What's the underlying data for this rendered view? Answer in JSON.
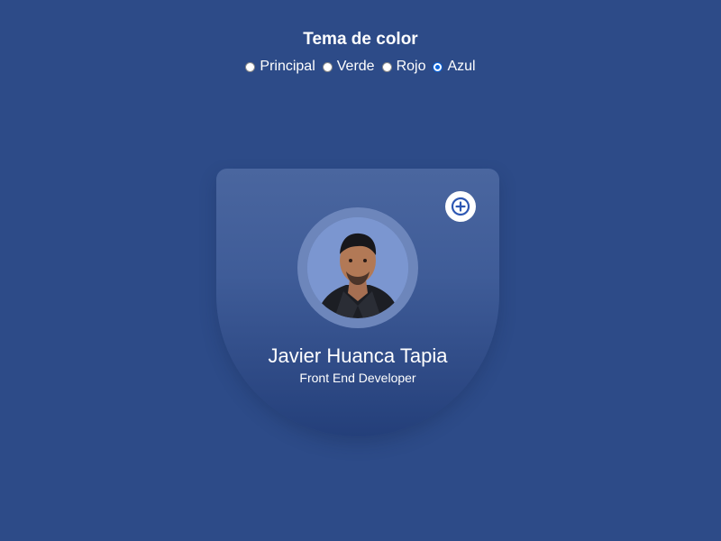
{
  "theme_selector": {
    "title": "Tema de color",
    "options": [
      {
        "label": "Principal",
        "checked": false
      },
      {
        "label": "Verde",
        "checked": false
      },
      {
        "label": "Rojo",
        "checked": false
      },
      {
        "label": "Azul",
        "checked": true
      }
    ]
  },
  "profile_card": {
    "name": "Javier Huanca Tapia",
    "role": "Front End Developer",
    "add_icon": "plus-circle-icon",
    "photo_icon": "profile-photo"
  },
  "colors": {
    "background": "#2d4b88",
    "card_top": "#4a669f",
    "card_bottom": "#243f7a",
    "accent": "#0b63d9",
    "text": "#ffffff"
  }
}
